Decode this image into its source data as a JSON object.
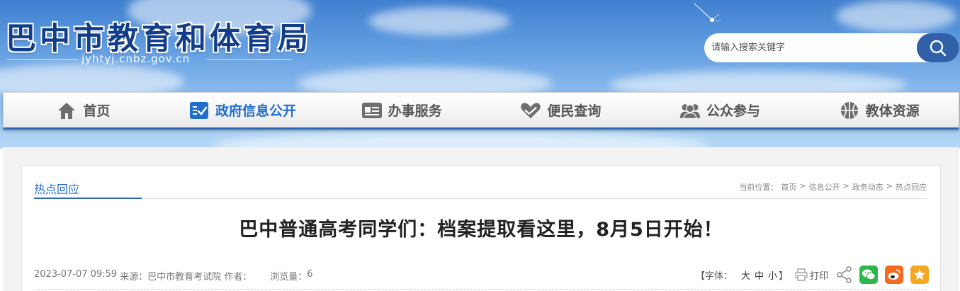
{
  "header": {
    "site_title": "巴中市教育和体育局",
    "site_url": "jyhtyj.cnbz.gov.cn",
    "search": {
      "placeholder": "请输入搜索关键字",
      "button_icon": "search-icon"
    }
  },
  "nav": {
    "items": [
      {
        "label": "首页",
        "icon": "home-icon"
      },
      {
        "label": "政府信息公开",
        "icon": "checklist-icon",
        "active": true
      },
      {
        "label": "办事服务",
        "icon": "id-card-icon"
      },
      {
        "label": "便民查询",
        "icon": "heart-hand-icon"
      },
      {
        "label": "公众参与",
        "icon": "people-icon"
      },
      {
        "label": "教体资源",
        "icon": "basketball-icon"
      }
    ]
  },
  "section": {
    "title": "热点回应",
    "breadcrumb": {
      "prefix": "当前位置：",
      "items": [
        "首页",
        "信息公开",
        "政务动态",
        "热点回应"
      ],
      "separator": ">"
    }
  },
  "article": {
    "title": "巴中普通高考同学们：档案提取看这里，8月5日开始！",
    "date": "2023-07-07 09:59",
    "source_label": "来源：",
    "source": "巴中市教育考试院",
    "author_label": "作者：",
    "author": "",
    "views_label": "浏览量：",
    "views": "6"
  },
  "tools": {
    "font_label": "【字体：",
    "font_sizes": [
      "大",
      "中",
      "小"
    ],
    "font_close": "】",
    "print_label": "打印",
    "icons": [
      "print-icon",
      "share-icon",
      "wechat-icon",
      "weibo-icon",
      "favorite-icon"
    ]
  },
  "colors": {
    "accent": "#1f6ecf",
    "nav_border": "#2f67b5",
    "wechat": "#2eb74a",
    "weibo": "#f46a20",
    "favorite": "#f5a623"
  }
}
